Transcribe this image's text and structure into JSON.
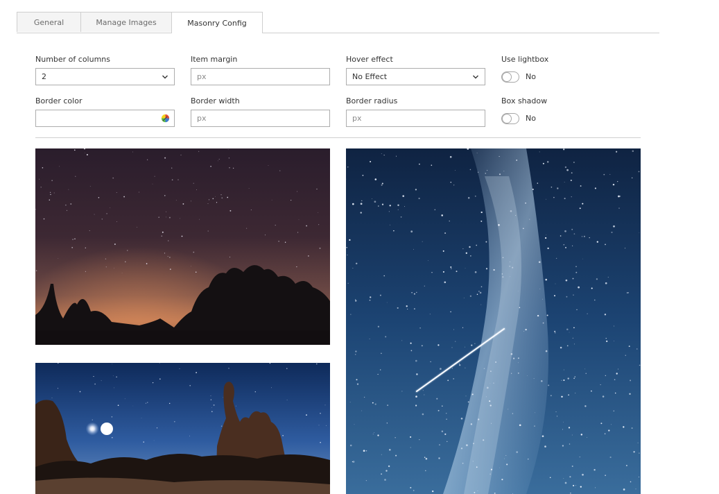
{
  "tabs": [
    {
      "label": "General",
      "active": false
    },
    {
      "label": "Manage Images",
      "active": false
    },
    {
      "label": "Masonry Config",
      "active": true
    }
  ],
  "form": {
    "columns": {
      "label": "Number of columns",
      "value": "2"
    },
    "item_margin": {
      "label": "Item margin",
      "placeholder": "px"
    },
    "hover_effect": {
      "label": "Hover effect",
      "value": "No Effect"
    },
    "use_lightbox": {
      "label": "Use lightbox",
      "state": "No"
    },
    "border_color": {
      "label": "Border color",
      "value": ""
    },
    "border_width": {
      "label": "Border width",
      "placeholder": "px"
    },
    "border_radius": {
      "label": "Border radius",
      "placeholder": "px"
    },
    "box_shadow": {
      "label": "Box shadow",
      "state": "No"
    }
  },
  "images": [
    {
      "name": "night-sky-trees-silhouette"
    },
    {
      "name": "milky-way-shooting-star"
    },
    {
      "name": "moonlit-rock-formations"
    }
  ],
  "colors": {
    "border": "#adadad",
    "tab_bg": "#f4f4f4",
    "divider": "#cfcfcf"
  }
}
